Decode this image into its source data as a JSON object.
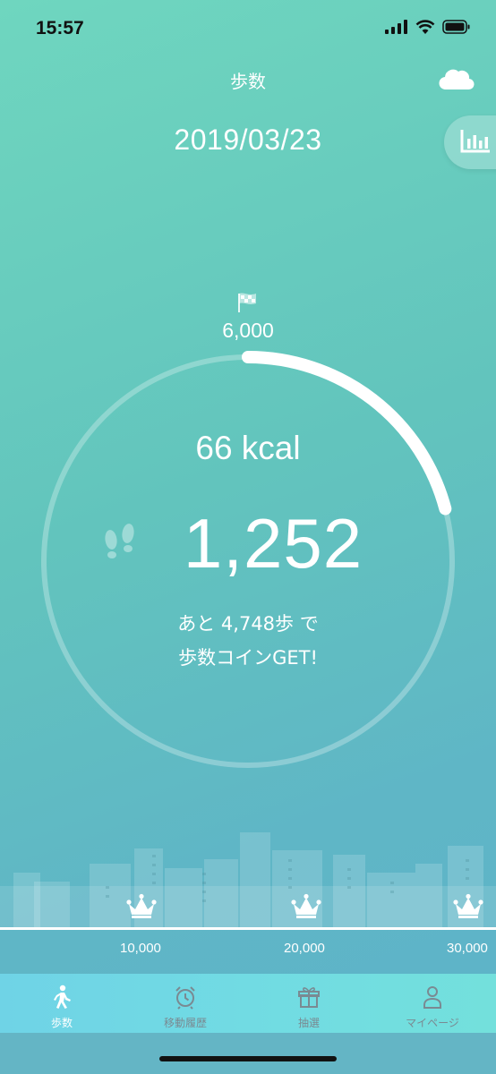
{
  "status_bar": {
    "time": "15:57"
  },
  "header": {
    "title": "歩数"
  },
  "date": "2019/03/23",
  "progress": {
    "goal": "6,000",
    "kcal": "66 kcal",
    "steps": "1,252",
    "steps_value": 1252,
    "goal_value": 6000,
    "remaining_line1": "あと 4,748歩 で",
    "remaining_line2": "歩数コインGET!"
  },
  "milestones": [
    {
      "label": "10,000"
    },
    {
      "label": "20,000"
    },
    {
      "label": "30,000"
    }
  ],
  "tabs": [
    {
      "label": "歩数",
      "icon": "walk-icon",
      "active": true
    },
    {
      "label": "移動履歴",
      "icon": "alarm-clock-icon",
      "active": false
    },
    {
      "label": "抽選",
      "icon": "gift-box-icon",
      "active": false
    },
    {
      "label": "マイページ",
      "icon": "person-icon",
      "active": false
    }
  ],
  "colors": {
    "accent": "#ffffff",
    "inactive_tab": "#7a8a92"
  }
}
